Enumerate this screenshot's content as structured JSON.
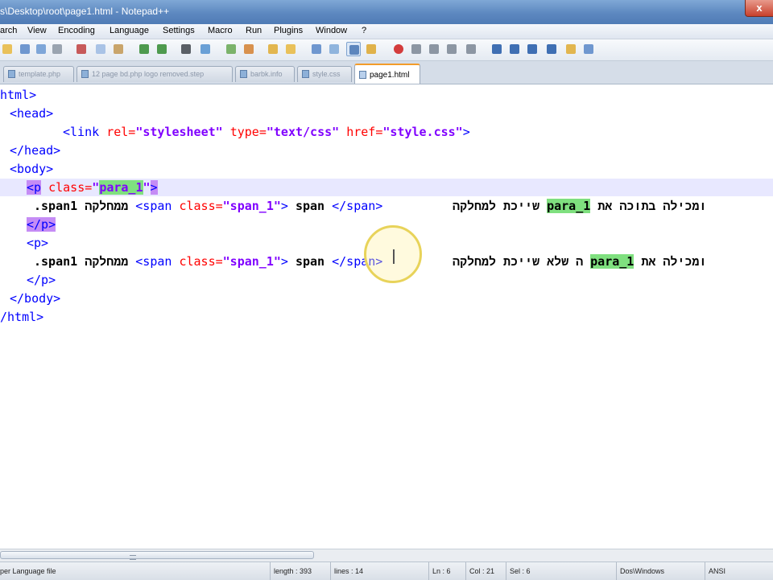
{
  "window": {
    "title": "s\\Desktop\\root\\page1.html - Notepad++",
    "close_label": "x"
  },
  "menu": [
    "arch",
    "View",
    "Encoding",
    "Language",
    "Settings",
    "Macro",
    "Run",
    "Plugins",
    "Window",
    "?"
  ],
  "toolbar_icons": [
    "open-file-icon",
    "save-icon",
    "save-all-icon",
    "close-file-icon",
    "print-icon",
    "cut-icon",
    "copy-icon",
    "paste-icon",
    "undo-icon",
    "redo-icon",
    "find-icon",
    "replace-icon",
    "zoom-in-icon",
    "zoom-out-icon",
    "sync-scroll-icon",
    "word-wrap-icon",
    "all-chars-icon",
    "indent-guide-icon",
    "user-lang-icon",
    "doc-map-icon",
    "record-macro-icon",
    "stop-macro-icon",
    "play-macro-icon",
    "run-macro-icon",
    "save-macro-icon",
    "show-list-icon",
    "up-icon",
    "down-icon",
    "column-icon",
    "function-list-icon",
    "spell-check-icon"
  ],
  "tabs": [
    {
      "label": "template.php",
      "active": false
    },
    {
      "label": "12 page bd.php logo removed.step",
      "active": false
    },
    {
      "label": "barbk.info",
      "active": false
    },
    {
      "label": "style.css",
      "active": false
    },
    {
      "label": "page1.html",
      "active": true
    }
  ],
  "code": {
    "line1": "html>",
    "line2": "<head>",
    "line3": {
      "open": "<link ",
      "a1": "rel=",
      "v1": "\"stylesheet\"",
      "a2": " type=",
      "v2": "\"text/css\"",
      "a3": " href=",
      "v3": "\"style.css\"",
      "close": ">"
    },
    "line4": "</head>",
    "line5": "<body>",
    "line6": {
      "open": "<p",
      "attr": " class=",
      "q1": "\"",
      "val": "para_1",
      "q2": "\"",
      "close": ">"
    },
    "line7": {
      "lead": ".span1 ממחלקה ",
      "open": "<span ",
      "attr": "class=",
      "val": "\"span_1\"",
      "gt": "> ",
      "txt": "span ",
      "closetag": "</span>",
      "rtl": "שייכת למחלקה ",
      "hl": "para_1",
      "rtl2": " ומכילה בתוכה את"
    },
    "line8": "</p>",
    "line9": "<p>",
    "line10": {
      "lead": ".span1 ממחלקה ",
      "open": "<span ",
      "attr": "class=",
      "val": "\"span_1\"",
      "gt": "> ",
      "txt": "span ",
      "closetag": "</span>",
      "rtl": "ה שלא שייכת למחלקה ",
      "hl": "para_1",
      "rtl2": " ומכילה את"
    },
    "line11": "</p>",
    "line12": "</body>",
    "line13": "/html>"
  },
  "status": {
    "type": "per Language file",
    "length": "length : 393",
    "lines": "lines : 14",
    "ln": "Ln : 6",
    "col": "Col : 21",
    "sel": "Sel : 6",
    "eol": "Dos\\Windows",
    "encoding": "ANSI"
  },
  "colors": {
    "tag": "#0000ff",
    "attr": "#ff0000",
    "value": "#8000ff",
    "match_highlight": "#7fe07f",
    "brace_highlight": "#c58cf5"
  }
}
